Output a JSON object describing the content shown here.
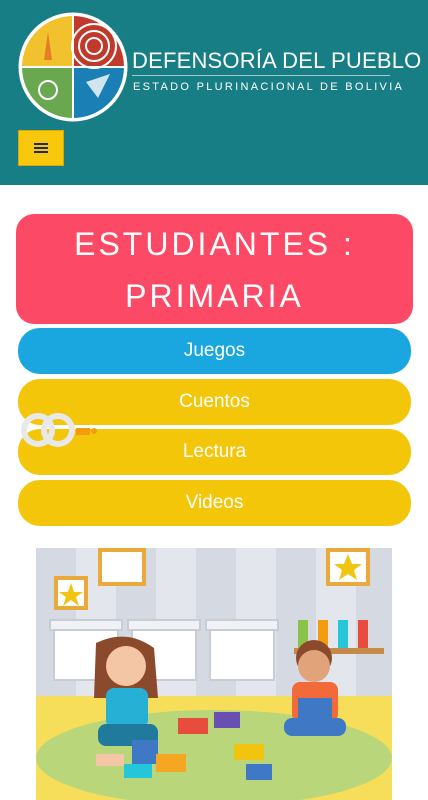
{
  "header": {
    "org_name": "DEFENSORÍA DEL PUEBLO",
    "org_subtitle": "ESTADO PLURINACIONAL DE BOLIVIA",
    "logo_icon": "defensoria-logo-icon",
    "menu_icon": "hamburger-menu-icon",
    "background_color": "#177e86"
  },
  "page": {
    "title_line1": "ESTUDIANTES :",
    "title_line2": "PRIMARIA",
    "title_color": "#fc4966"
  },
  "nav": {
    "juegos": "Juegos",
    "cuentos": "Cuentos",
    "lectura": "Lectura",
    "videos": "Videos",
    "blue": "#1aa7e0",
    "yellow": "#f3c60a"
  },
  "illustration": {
    "description_icon": "children-playing-blocks-illustration"
  }
}
